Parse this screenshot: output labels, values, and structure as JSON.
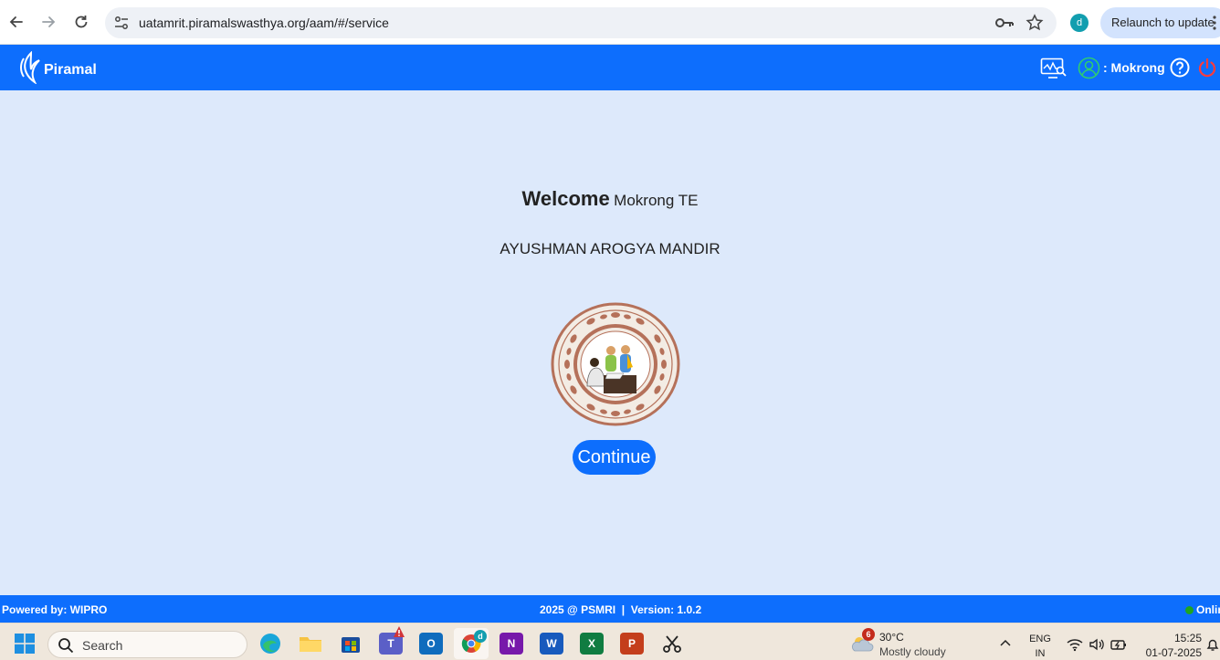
{
  "browser": {
    "url": "uatamrit.piramalswasthya.org/aam/#/service",
    "profile_initial": "d",
    "relaunch_label": "Relaunch to update"
  },
  "header": {
    "logo_text": "Piramal",
    "user_label": ": Mokrong"
  },
  "main": {
    "welcome_label": "Welcome",
    "welcome_name": "Mokrong TE",
    "facility_name": "AYUSHMAN AROGYA MANDIR",
    "continue_label": "Continue"
  },
  "footer": {
    "powered_by": "Powered by: WIPRO",
    "copyright_version": "2025 @ PSMRI  |  Version: 1.0.2",
    "status": "Online"
  },
  "taskbar": {
    "search_placeholder": "Search",
    "apps": [
      {
        "name": "edge",
        "label": ""
      },
      {
        "name": "file-explorer",
        "label": ""
      },
      {
        "name": "store",
        "label": ""
      },
      {
        "name": "teams",
        "label": "T"
      },
      {
        "name": "outlook",
        "label": "O"
      },
      {
        "name": "chrome",
        "label": ""
      },
      {
        "name": "onenote",
        "label": "N"
      },
      {
        "name": "word",
        "label": "W"
      },
      {
        "name": "excel",
        "label": "X"
      },
      {
        "name": "powerpoint",
        "label": "P"
      },
      {
        "name": "snipping",
        "label": ""
      }
    ],
    "chrome_badge": "d",
    "weather_badge": "6",
    "weather_temp": "30°C",
    "weather_desc": "Mostly cloudy",
    "lang_line1": "ENG",
    "lang_line2": "IN",
    "time": "15:25",
    "date": "01-07-2025"
  },
  "colors": {
    "primary": "#0d6efd",
    "page_bg": "#dde9fb",
    "emblem_brown": "#b5715a",
    "power_red": "#ff3b3b",
    "online_green": "#1fa51f"
  }
}
